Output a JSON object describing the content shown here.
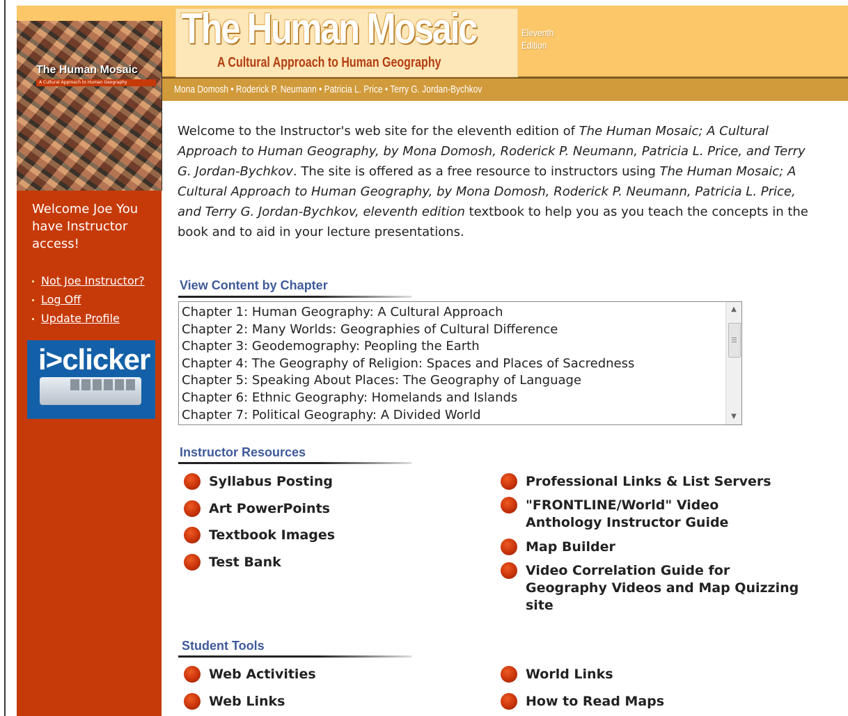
{
  "header": {
    "title": "The Human Mosaic",
    "edition": "Eleventh Edition",
    "subtitle": "A Cultural Approach to Human Geography",
    "authors": "Mona Domosh • Roderick P. Neumann • Patricia L. Price • Terry G. Jordan-Bychkov"
  },
  "cover": {
    "title": "The Human Mosaic",
    "subtitle": "A Cultural Approach to Human Geography"
  },
  "sidebar": {
    "welcome": "Welcome Joe You have Instructor access!",
    "links": [
      {
        "label": "Not Joe Instructor?"
      },
      {
        "label": "Log Off"
      },
      {
        "label": "Update Profile"
      }
    ],
    "iclicker": {
      "label": "i>clicker"
    }
  },
  "intro": {
    "p1": "Welcome to the Instructor's web site for the eleventh edition of ",
    "title1": "The Human Mosaic; A Cultural Approach to Human Geography, by Mona Domosh, Roderick P. Neumann, Patricia L. Price, and Terry G. Jordan-Bychkov",
    "p2": ". The site is offered as a free resource to instructors using ",
    "title2": "The Human Mosaic; A Cultural Approach to Human Geography, by Mona Domosh, Roderick P. Neumann, Patricia L. Price, and Terry G. Jordan-Bychkov, eleventh edition",
    "p3": " textbook to help you as you teach the concepts in the book and to aid in your lecture presentations."
  },
  "chapters": {
    "heading": "View Content by Chapter",
    "items": [
      "Chapter 1: Human Geography: A Cultural Approach",
      "Chapter 2: Many Worlds: Geographies of Cultural Difference",
      "Chapter 3: Geodemography: Peopling the Earth",
      "Chapter 4: The Geography of Religion: Spaces and Places of Sacredness",
      "Chapter 5: Speaking About Places: The Geography of Language",
      "Chapter 6: Ethnic Geography: Homelands and Islands",
      "Chapter 7: Political Geography: A Divided World"
    ]
  },
  "instructor_resources": {
    "heading": "Instructor Resources",
    "left": [
      "Syllabus Posting",
      "Art PowerPoints",
      "Textbook Images",
      "Test Bank"
    ],
    "right": [
      "Professional Links & List Servers",
      "\"FRONTLINE/World\" Video Anthology Instructor Guide",
      "Map Builder",
      "Video Correlation Guide for Geography Videos and Map Quizzing site"
    ]
  },
  "student_tools": {
    "heading": "Student Tools",
    "left": [
      "Web Activities",
      "Web Links"
    ],
    "right": [
      "World Links",
      "How to Read Maps"
    ]
  },
  "colors": {
    "header_bg": "#fbc769",
    "author_bar": "#d19a3a",
    "sidebar_bg": "#c63a09",
    "section_heading": "#3f5a9a",
    "bullet": "#c8330a",
    "iclicker_bg": "#1460a8"
  }
}
